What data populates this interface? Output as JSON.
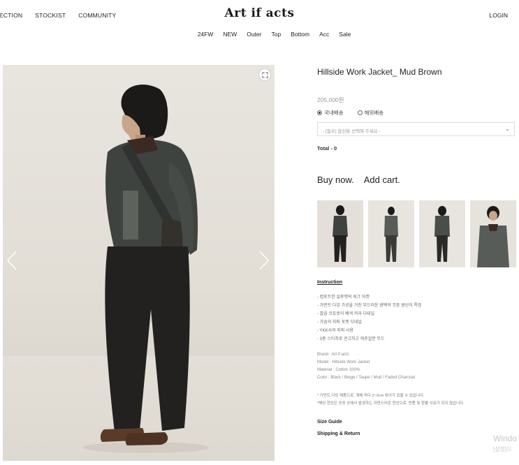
{
  "header": {
    "brand": "Art if acts",
    "nav": [
      "LECTION",
      "STOCKIST",
      "COMMUNITY"
    ],
    "login": "LOGIN",
    "categories": [
      "24FW",
      "NEW",
      "Outer",
      "Top",
      "Bottom",
      "Acc",
      "Sale"
    ]
  },
  "product": {
    "title": "Hillside Work Jacket_ Mud Brown",
    "price": "205,000원",
    "shipping_options": [
      {
        "label": "국내배송",
        "selected": true
      },
      {
        "label": "해외배송",
        "selected": false
      }
    ],
    "option_select": "- [필수] 옵션을 선택해 주세요 -",
    "total": "Total - 0",
    "buy_now": "Buy now.",
    "add_cart": "Add cart."
  },
  "details": {
    "instruction_title": "Instruction",
    "bullets": [
      "- 컴포트한 실루엣의 워크 자켓",
      "- 가먼트 다잉 가공을 거친 부드러운 광택의 코튼 원단이 특징",
      "- 깔끔 코듀로이 배색 카라 디테일",
      "- 가슴의 지퍼 포켓 디테일",
      "- YKK사의 지퍼 사용",
      "- 3중 스티치로 견고하고 캐주얼한 무드"
    ],
    "specs": [
      "Brand : Art if acts",
      "Model : Hillside Work Jacket",
      "Material : Cotton 100%",
      "Color : Black / Beige / Taupe / Mud / Faded Charcoal"
    ],
    "notes": [
      "* 가먼트 다잉 제품으로, 개체 마다 2~3cm 차이가 있을 수 있습니다.",
      "*해당 현상은 공정 상에서 발생하는 자연스러운 현상으로, 반품 및 환불 사유가 되지 않습니다."
    ],
    "size_guide": "Size Guide",
    "shipping_return": "Shipping & Return"
  },
  "watermark": {
    "line1": "Windo",
    "line2": "[설정]으"
  },
  "colors": {
    "jacket": "#3f4340",
    "pants": "#22211f",
    "shoes": "#5a3a28",
    "background": "#e6e2db"
  }
}
